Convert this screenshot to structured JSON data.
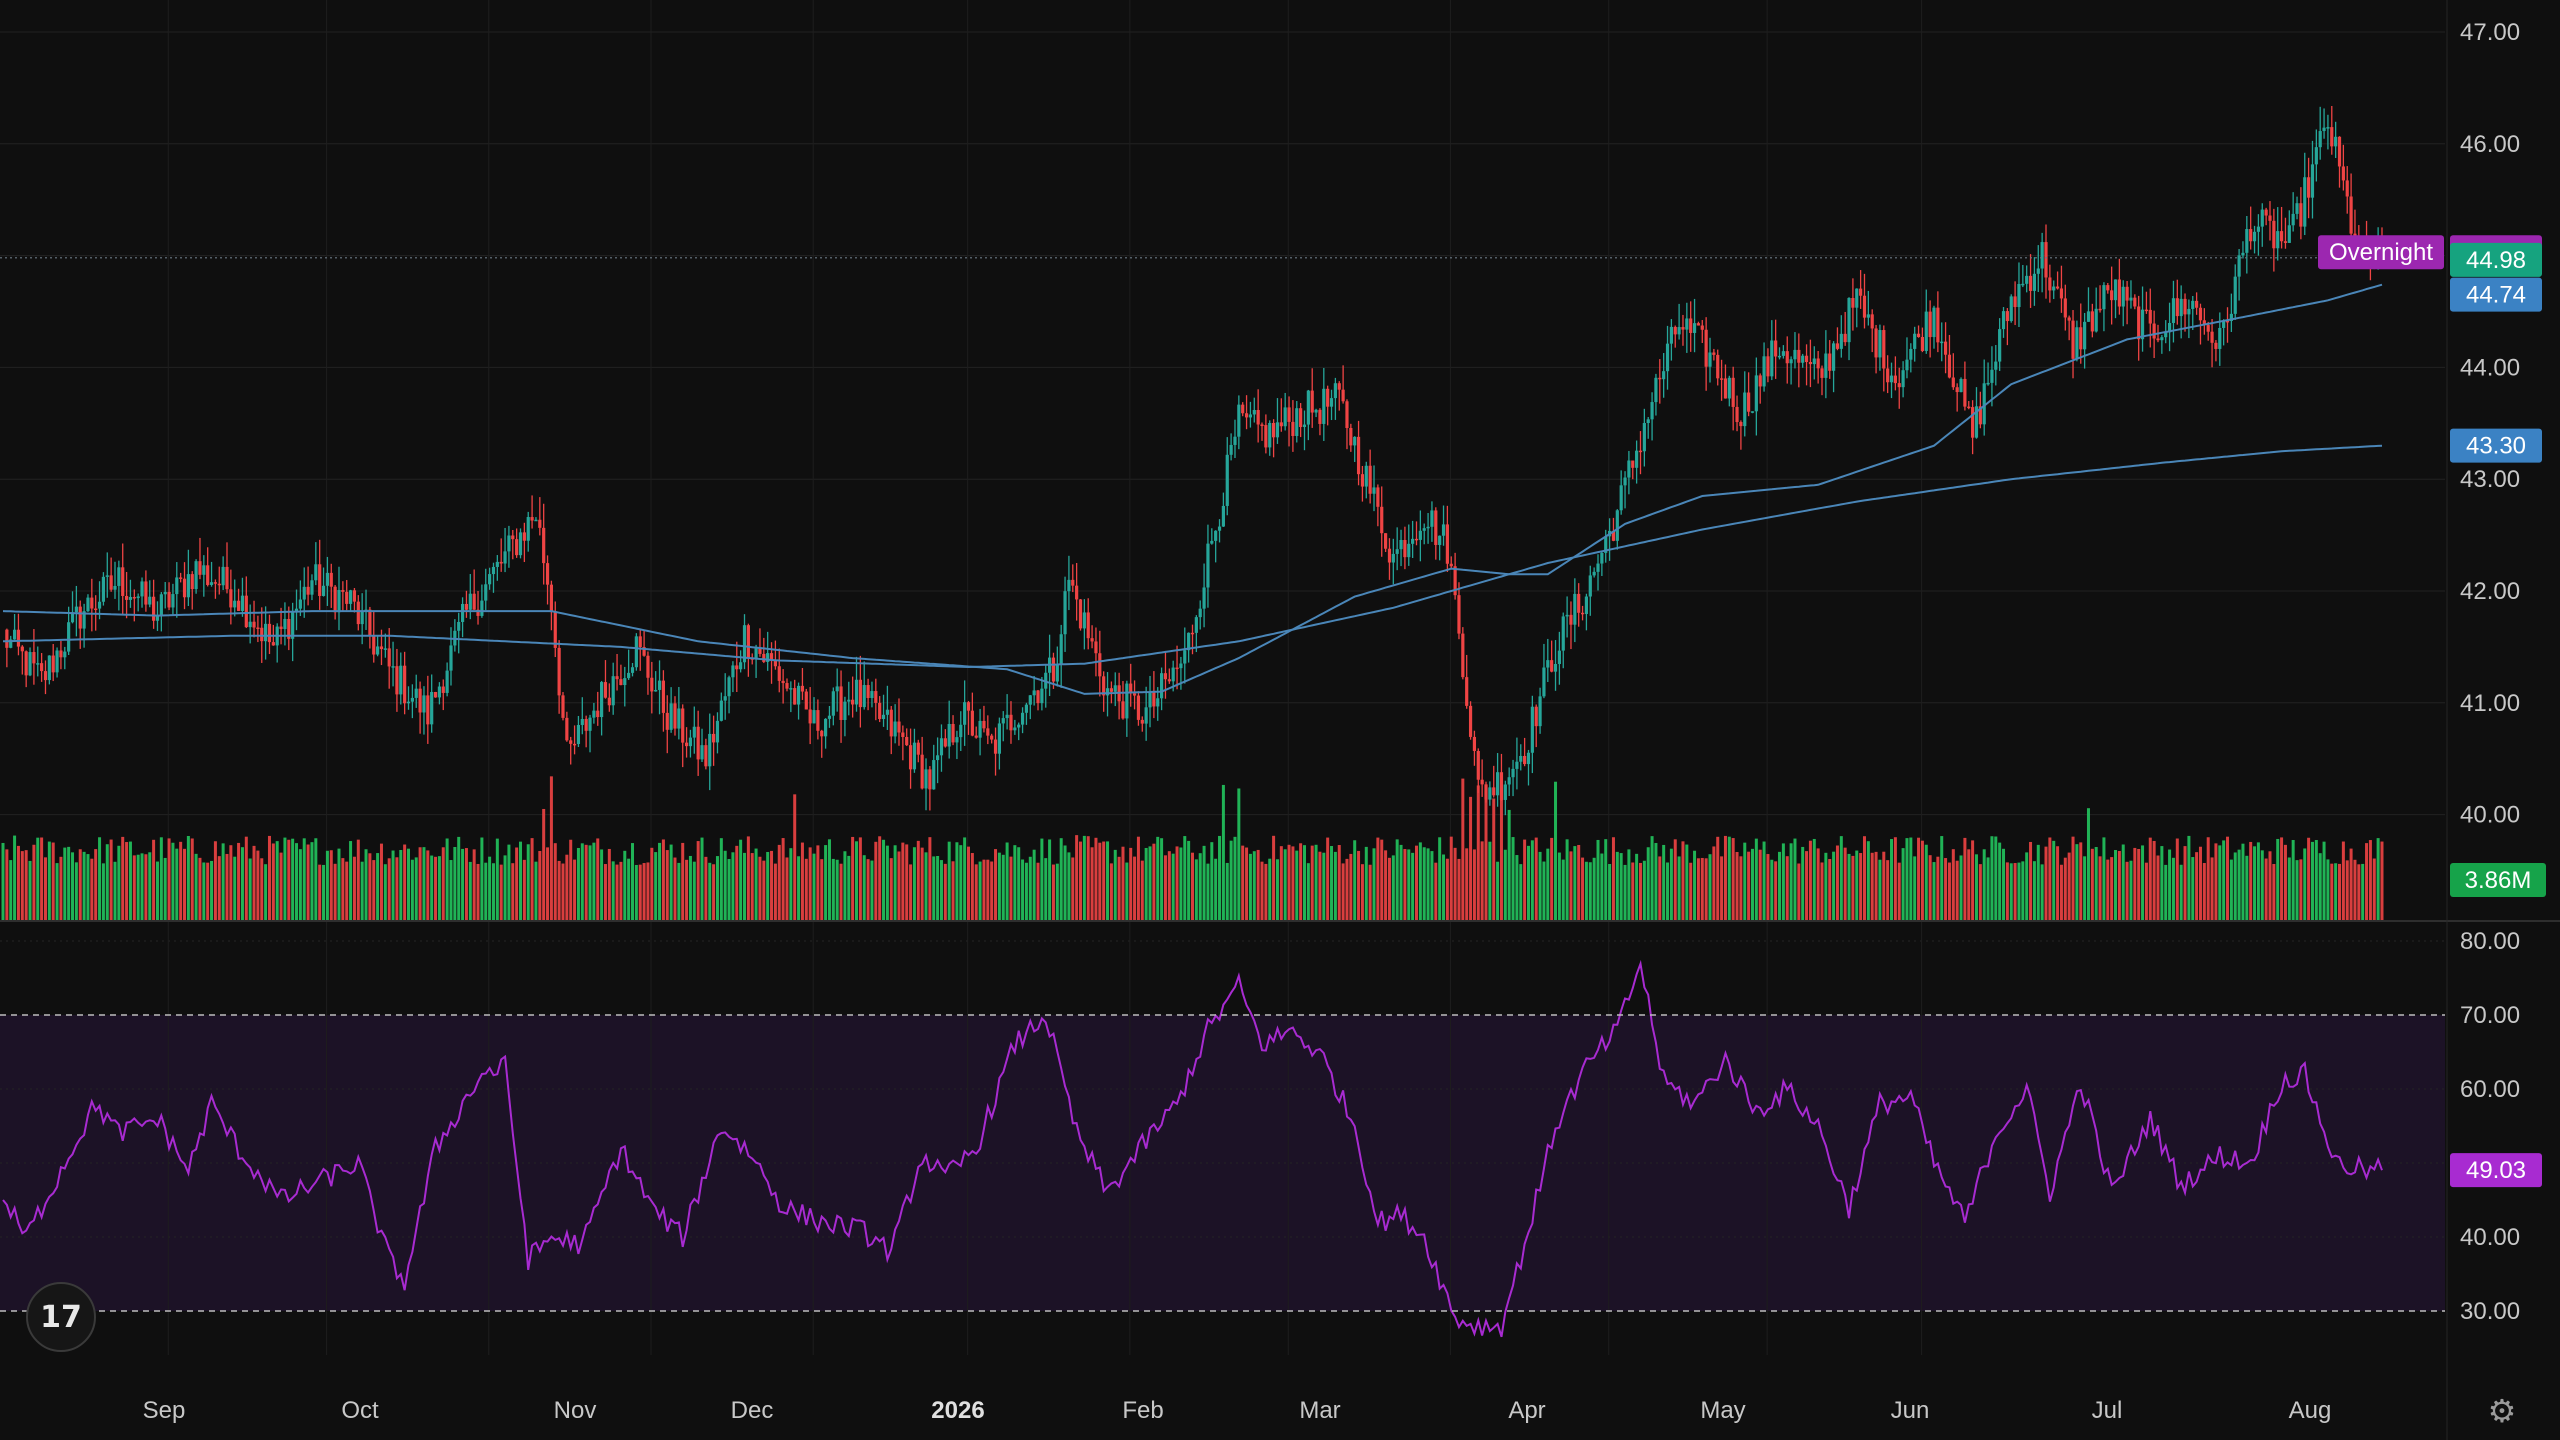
{
  "chart_data": {
    "type": "candlestick",
    "price_axis": {
      "range": [
        39.0,
        47.3
      ],
      "ticks": [
        "47.00",
        "46.00",
        "45.00",
        "44.00",
        "43.00",
        "42.00",
        "41.00",
        "40.00"
      ],
      "grid": true
    },
    "rsi_axis": {
      "range": [
        25,
        82
      ],
      "ticks": [
        "80.00",
        "70.00",
        "60.00",
        "50.00",
        "40.00",
        "30.00"
      ],
      "overbought": 70,
      "oversold": 30
    },
    "time_axis": {
      "labels": [
        "Sep",
        "Oct",
        "Nov",
        "Dec",
        "2026",
        "Feb",
        "Mar",
        "Apr",
        "May",
        "Jun",
        "Jul",
        "Aug"
      ],
      "bold_label": "2026"
    },
    "markers": {
      "overnight_label": "Overnight",
      "overnight_price": "45.03",
      "last_price": "44.98",
      "ma_short_value": "44.74",
      "ma_long_value": "43.30",
      "volume_value": "3.86M",
      "rsi_value": "49.03"
    },
    "colors": {
      "up": "#26a69a",
      "up_bright": "#22c55e",
      "down": "#ef4444",
      "ma": "#4a86b8",
      "rsi": "#a82bd1",
      "rsi_band": "#1c1226",
      "overnight": "#9c27b0",
      "last_price": "#16a37f",
      "ma_badge": "#3b82c4"
    },
    "series_anchors": {
      "close": [
        [
          0,
          41.6
        ],
        [
          10,
          41.2
        ],
        [
          20,
          41.8
        ],
        [
          30,
          42.1
        ],
        [
          40,
          41.8
        ],
        [
          50,
          42.2
        ],
        [
          60,
          42.0
        ],
        [
          70,
          41.5
        ],
        [
          80,
          42.1
        ],
        [
          90,
          41.9
        ],
        [
          100,
          41.3
        ],
        [
          110,
          40.9
        ],
        [
          120,
          41.8
        ],
        [
          130,
          42.3
        ],
        [
          138,
          42.7
        ],
        [
          142,
          41.9
        ],
        [
          146,
          40.5
        ],
        [
          154,
          41.0
        ],
        [
          164,
          41.5
        ],
        [
          172,
          40.9
        ],
        [
          182,
          40.5
        ],
        [
          192,
          41.6
        ],
        [
          200,
          41.3
        ],
        [
          210,
          40.8
        ],
        [
          220,
          41.1
        ],
        [
          232,
          40.7
        ],
        [
          240,
          40.3
        ],
        [
          248,
          40.9
        ],
        [
          256,
          40.6
        ],
        [
          264,
          41.0
        ],
        [
          272,
          41.3
        ],
        [
          276,
          42.1
        ],
        [
          280,
          41.7
        ],
        [
          286,
          41.1
        ],
        [
          296,
          40.9
        ],
        [
          306,
          41.4
        ],
        [
          312,
          42.3
        ],
        [
          320,
          43.5
        ],
        [
          328,
          43.4
        ],
        [
          336,
          43.6
        ],
        [
          346,
          43.7
        ],
        [
          354,
          42.9
        ],
        [
          360,
          42.3
        ],
        [
          368,
          42.7
        ],
        [
          374,
          42.4
        ],
        [
          378,
          41.4
        ],
        [
          382,
          40.2
        ],
        [
          388,
          40.3
        ],
        [
          394,
          40.6
        ],
        [
          402,
          41.5
        ],
        [
          410,
          42.0
        ],
        [
          418,
          42.7
        ],
        [
          426,
          43.6
        ],
        [
          434,
          44.4
        ],
        [
          442,
          44.1
        ],
        [
          450,
          43.6
        ],
        [
          460,
          44.2
        ],
        [
          470,
          43.9
        ],
        [
          480,
          44.6
        ],
        [
          490,
          43.9
        ],
        [
          500,
          44.5
        ],
        [
          510,
          43.4
        ],
        [
          520,
          44.6
        ],
        [
          528,
          45.0
        ],
        [
          536,
          44.2
        ],
        [
          546,
          44.7
        ],
        [
          556,
          44.3
        ],
        [
          566,
          44.6
        ],
        [
          574,
          44.2
        ],
        [
          582,
          45.3
        ],
        [
          592,
          45.1
        ],
        [
          602,
          46.2
        ],
        [
          610,
          45.0
        ],
        [
          616,
          44.9
        ]
      ],
      "ma_short": [
        [
          0,
          41.82
        ],
        [
          40,
          41.78
        ],
        [
          80,
          41.82
        ],
        [
          110,
          41.82
        ],
        [
          142,
          41.82
        ],
        [
          180,
          41.55
        ],
        [
          220,
          41.4
        ],
        [
          260,
          41.3
        ],
        [
          280,
          41.08
        ],
        [
          300,
          41.1
        ],
        [
          320,
          41.4
        ],
        [
          350,
          41.95
        ],
        [
          375,
          42.2
        ],
        [
          390,
          42.15
        ],
        [
          400,
          42.15
        ],
        [
          420,
          42.6
        ],
        [
          440,
          42.85
        ],
        [
          470,
          42.95
        ],
        [
          500,
          43.3
        ],
        [
          520,
          43.85
        ],
        [
          550,
          44.25
        ],
        [
          580,
          44.45
        ],
        [
          602,
          44.6
        ],
        [
          616,
          44.74
        ]
      ],
      "ma_long": [
        [
          0,
          41.55
        ],
        [
          60,
          41.6
        ],
        [
          100,
          41.6
        ],
        [
          160,
          41.5
        ],
        [
          200,
          41.38
        ],
        [
          250,
          41.32
        ],
        [
          280,
          41.35
        ],
        [
          320,
          41.55
        ],
        [
          360,
          41.85
        ],
        [
          400,
          42.25
        ],
        [
          440,
          42.55
        ],
        [
          480,
          42.8
        ],
        [
          520,
          43.0
        ],
        [
          560,
          43.15
        ],
        [
          590,
          43.25
        ],
        [
          616,
          43.3
        ]
      ],
      "rsi": [
        [
          0,
          45
        ],
        [
          6,
          40
        ],
        [
          12,
          46
        ],
        [
          18,
          52
        ],
        [
          24,
          58
        ],
        [
          30,
          54
        ],
        [
          40,
          56
        ],
        [
          48,
          49
        ],
        [
          54,
          58
        ],
        [
          62,
          51
        ],
        [
          72,
          45
        ],
        [
          84,
          48
        ],
        [
          92,
          50
        ],
        [
          100,
          37
        ],
        [
          104,
          34
        ],
        [
          112,
          52
        ],
        [
          124,
          62
        ],
        [
          130,
          63
        ],
        [
          136,
          37
        ],
        [
          142,
          40
        ],
        [
          150,
          39
        ],
        [
          160,
          52
        ],
        [
          168,
          44
        ],
        [
          176,
          40
        ],
        [
          186,
          55
        ],
        [
          194,
          51
        ],
        [
          202,
          44
        ],
        [
          212,
          42
        ],
        [
          222,
          41
        ],
        [
          230,
          38
        ],
        [
          238,
          51
        ],
        [
          244,
          48
        ],
        [
          252,
          52
        ],
        [
          262,
          66
        ],
        [
          270,
          70
        ],
        [
          278,
          54
        ],
        [
          286,
          46
        ],
        [
          296,
          53
        ],
        [
          304,
          58
        ],
        [
          312,
          68
        ],
        [
          320,
          74
        ],
        [
          326,
          66
        ],
        [
          334,
          68
        ],
        [
          342,
          64
        ],
        [
          350,
          55
        ],
        [
          356,
          42
        ],
        [
          362,
          43
        ],
        [
          368,
          40
        ],
        [
          376,
          29
        ],
        [
          382,
          28
        ],
        [
          388,
          28
        ],
        [
          394,
          39
        ],
        [
          402,
          55
        ],
        [
          410,
          63
        ],
        [
          418,
          68
        ],
        [
          424,
          77
        ],
        [
          430,
          61
        ],
        [
          438,
          58
        ],
        [
          446,
          64
        ],
        [
          454,
          57
        ],
        [
          462,
          60
        ],
        [
          470,
          55
        ],
        [
          478,
          44
        ],
        [
          486,
          58
        ],
        [
          494,
          59
        ],
        [
          500,
          50
        ],
        [
          508,
          42
        ],
        [
          516,
          54
        ],
        [
          524,
          60
        ],
        [
          530,
          46
        ],
        [
          538,
          61
        ],
        [
          546,
          46
        ],
        [
          556,
          56
        ],
        [
          564,
          47
        ],
        [
          574,
          51
        ],
        [
          582,
          50
        ],
        [
          590,
          61
        ],
        [
          596,
          62
        ],
        [
          604,
          50
        ],
        [
          612,
          49
        ],
        [
          616,
          49.03
        ]
      ]
    }
  }
}
